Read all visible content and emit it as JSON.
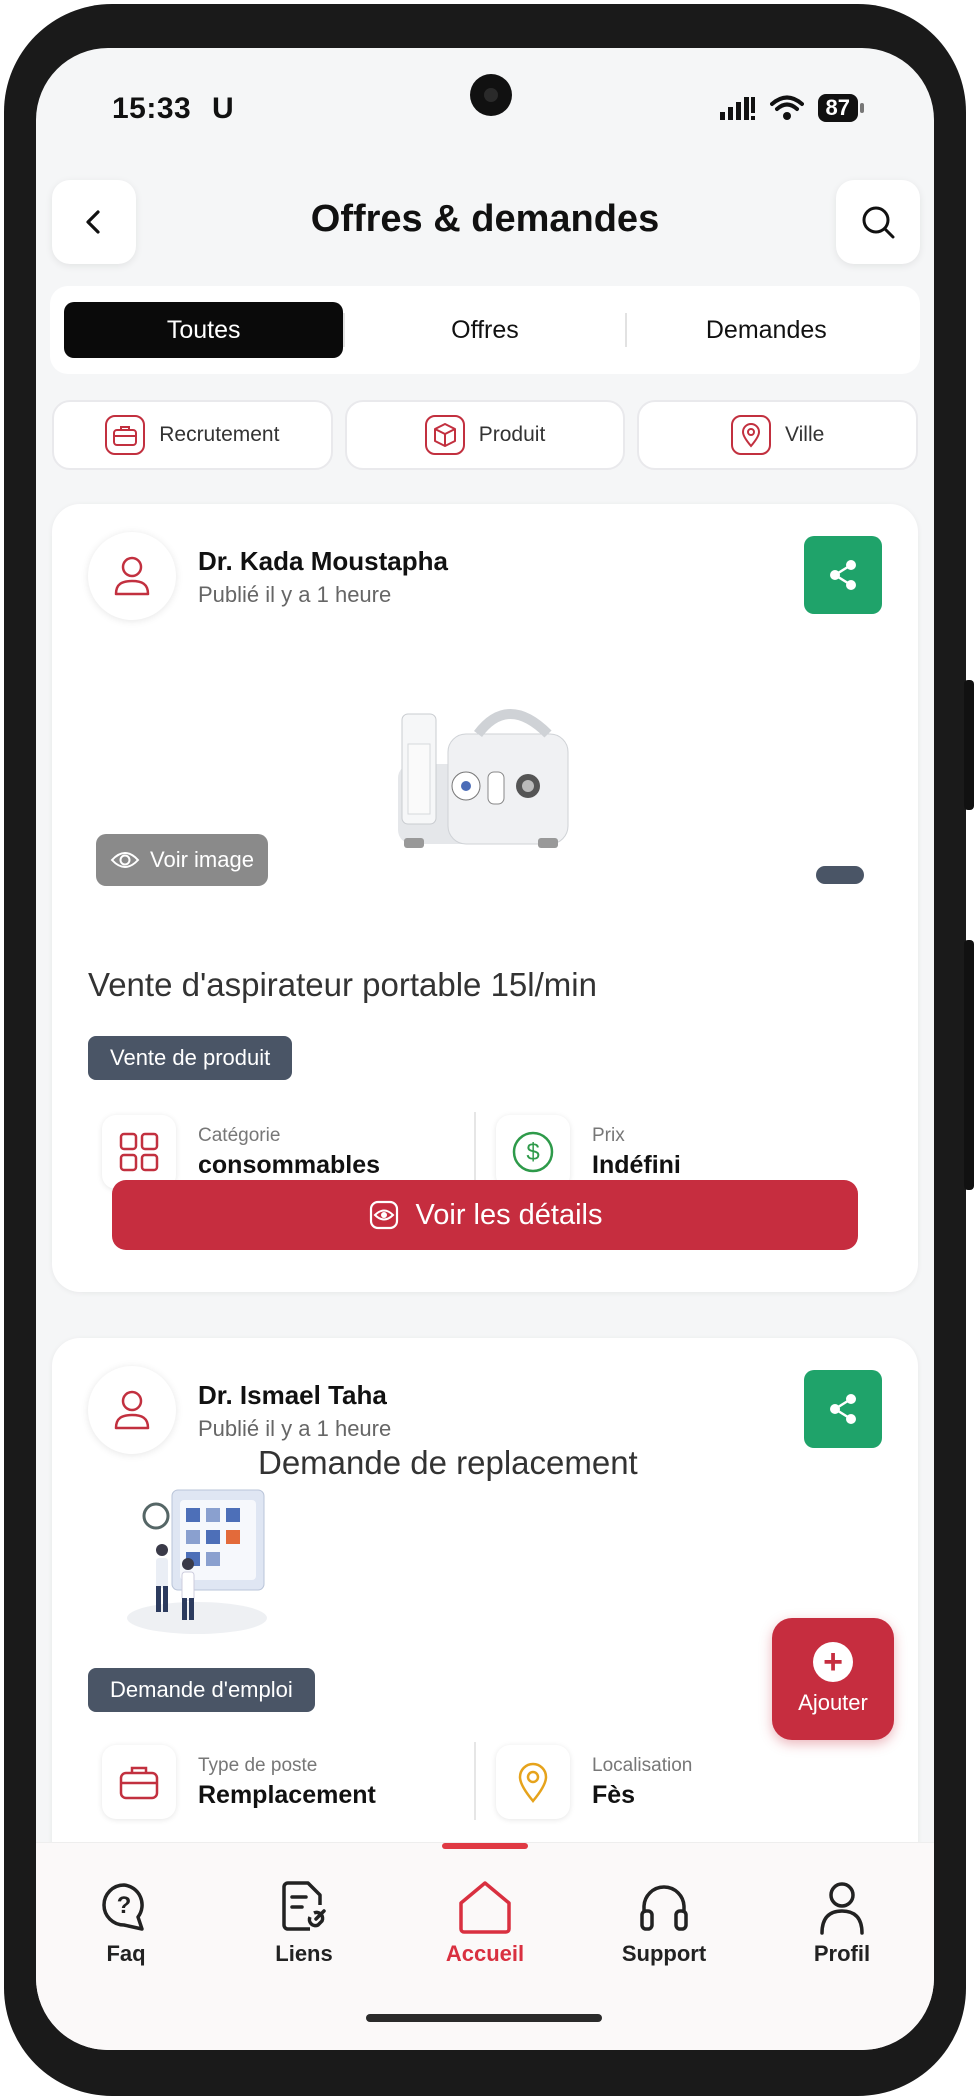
{
  "status": {
    "time": "15:33",
    "u_badge": "U",
    "battery": "87"
  },
  "header": {
    "title": "Offres & demandes"
  },
  "segments": [
    "Toutes",
    "Offres",
    "Demandes"
  ],
  "filters": [
    {
      "label": "Recrutement",
      "icon": "briefcase-icon"
    },
    {
      "label": "Produit",
      "icon": "box-icon"
    },
    {
      "label": "Ville",
      "icon": "map-pin-icon"
    }
  ],
  "posts": [
    {
      "author": "Dr. Kada Moustapha",
      "posted": "Publié il y a 1 heure",
      "voir_image": "Voir image",
      "title": "Vente d'aspirateur portable 15l/min",
      "tag": "Vente de produit",
      "info": [
        {
          "label": "Catégorie",
          "value": "consommables",
          "icon": "grid-icon"
        },
        {
          "label": "Prix",
          "value": "Indéfini",
          "icon": "dollar-icon"
        }
      ],
      "details_button": "Voir les détails"
    },
    {
      "author": "Dr. Ismael Taha",
      "posted": "Publié il y a 1 heure",
      "title": "Demande de replacement",
      "tag": "Demande d'emploi",
      "info": [
        {
          "label": "Type de poste",
          "value": "Remplacement",
          "icon": "briefcase-icon"
        },
        {
          "label": "Localisation",
          "value": "Fès",
          "icon": "map-pin-icon"
        }
      ]
    }
  ],
  "fab": {
    "label": "Ajouter"
  },
  "bottom_nav": [
    {
      "label": "Faq",
      "icon": "question-chat-icon",
      "active": false
    },
    {
      "label": "Liens",
      "icon": "link-doc-icon",
      "active": false
    },
    {
      "label": "Accueil",
      "icon": "home-icon",
      "active": true
    },
    {
      "label": "Support",
      "icon": "headphones-icon",
      "active": false
    },
    {
      "label": "Profil",
      "icon": "user-icon",
      "active": false
    }
  ],
  "colors": {
    "primary": "#c62d3f",
    "share": "#1fa36a",
    "tag": "#4a5566",
    "active_nav": "#d93040"
  }
}
